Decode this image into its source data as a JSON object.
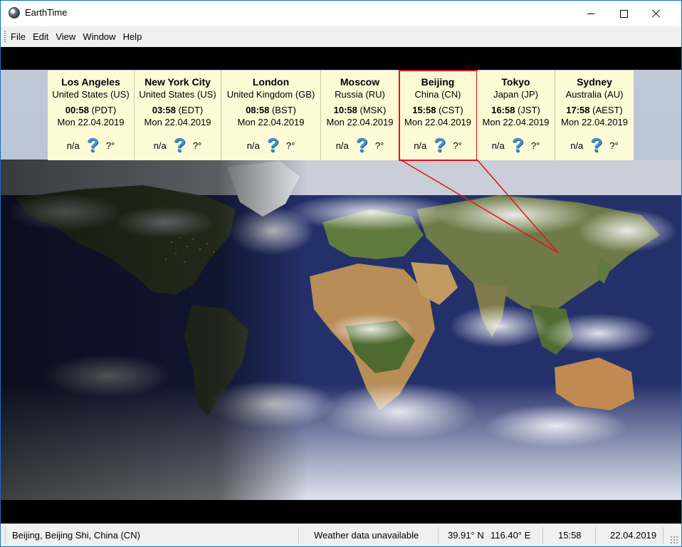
{
  "window": {
    "title": "EarthTime"
  },
  "menu": [
    "File",
    "Edit",
    "View",
    "Window",
    "Help"
  ],
  "colors": {
    "panel_bg": "#fdfbd6",
    "selection": "#e0141a",
    "weather_icon": "#3d8fd6"
  },
  "cities": [
    {
      "name": "Los Angeles",
      "country": "United States (US)",
      "time": "00:58",
      "zone": "(PDT)",
      "date": "Mon 22.04.2019",
      "weather": "n/a",
      "temp": "?°",
      "icon": "question-mark-icon"
    },
    {
      "name": "New York City",
      "country": "United States (US)",
      "time": "03:58",
      "zone": "(EDT)",
      "date": "Mon 22.04.2019",
      "weather": "n/a",
      "temp": "?°",
      "icon": "question-mark-icon"
    },
    {
      "name": "London",
      "country": "United Kingdom (GB)",
      "time": "08:58",
      "zone": "(BST)",
      "date": "Mon 22.04.2019",
      "weather": "n/a",
      "temp": "?°",
      "icon": "question-mark-icon"
    },
    {
      "name": "Moscow",
      "country": "Russia (RU)",
      "time": "10:58",
      "zone": "(MSK)",
      "date": "Mon 22.04.2019",
      "weather": "n/a",
      "temp": "?°",
      "icon": "question-mark-icon"
    },
    {
      "name": "Beijing",
      "country": "China (CN)",
      "time": "15:58",
      "zone": "(CST)",
      "date": "Mon 22.04.2019",
      "weather": "n/a",
      "temp": "?°",
      "icon": "question-mark-icon",
      "selected": true
    },
    {
      "name": "Tokyo",
      "country": "Japan (JP)",
      "time": "16:58",
      "zone": "(JST)",
      "date": "Mon 22.04.2019",
      "weather": "n/a",
      "temp": "?°",
      "icon": "question-mark-icon"
    },
    {
      "name": "Sydney",
      "country": "Australia (AU)",
      "time": "17:58",
      "zone": "(AEST)",
      "date": "Mon 22.04.2019",
      "weather": "n/a",
      "temp": "?°",
      "icon": "question-mark-icon"
    }
  ],
  "status": {
    "location": "Beijing, Beijing Shi, China (CN)",
    "weather": "Weather data unavailable",
    "latitude": "39.91° N",
    "longitude": "116.40° E",
    "time": "15:58",
    "date": "22.04.2019"
  }
}
